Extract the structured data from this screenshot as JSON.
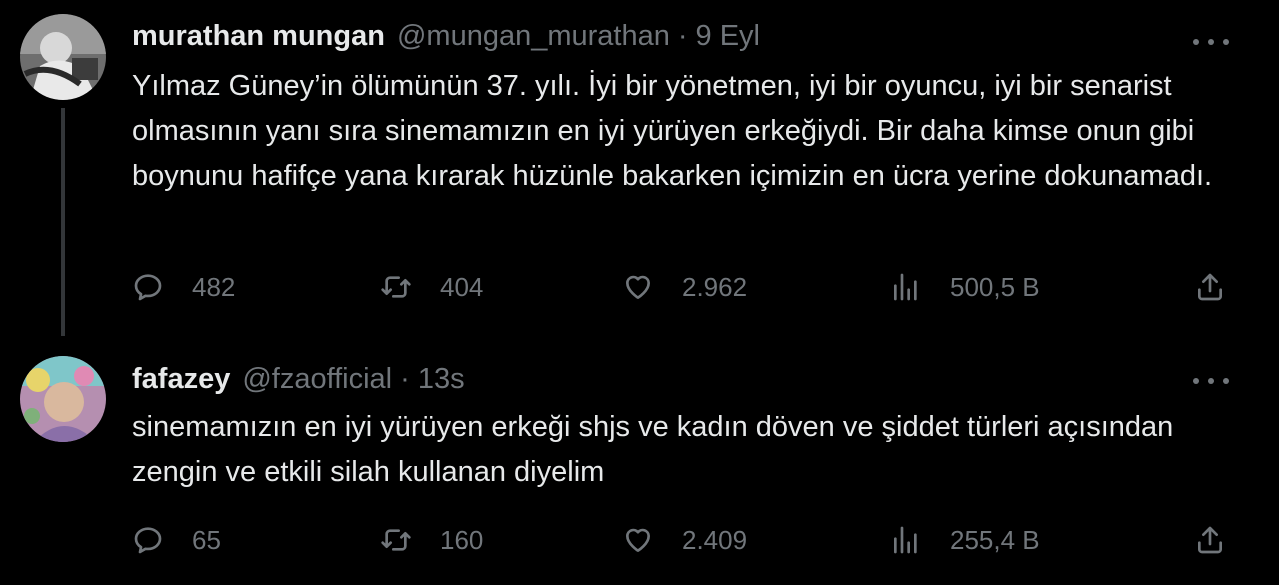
{
  "tweets": [
    {
      "author_name": "murathan mungan",
      "handle": "@mungan_murathan",
      "separator": "·",
      "time": "9 Eyl",
      "text": "Yılmaz Güney’in ölümünün 37.  yılı. İyi bir yönetmen, iyi bir oyuncu, iyi bir senarist olmasının yanı sıra sinemamızın en iyi yürüyen erkeğiydi. Bir daha kimse onun gibi boynunu hafifçe yana kırarak hüzünle bakarken içimizin en ücra yerine dokunamadı.",
      "replies": "482",
      "retweets": "404",
      "likes": "2.962",
      "views": "500,5 B"
    },
    {
      "author_name": "fafazey",
      "handle": "@fzaofficial",
      "separator": "·",
      "time": "13s",
      "text": "sinemamızın en iyi yürüyen erkeği shjs ve kadın döven ve şiddet türleri açısından zengin ve etkili silah kullanan diyelim",
      "replies": "65",
      "retweets": "160",
      "likes": "2.409",
      "views": "255,4 B"
    }
  ],
  "icons": {
    "reply": "reply-icon",
    "retweet": "retweet-icon",
    "like": "heart-icon",
    "views": "views-chart-icon",
    "share": "share-icon",
    "more": "more-dots-icon"
  },
  "colors": {
    "background": "#000000",
    "text": "#e7e9ea",
    "secondary": "#71767b",
    "thread_line": "#333639"
  }
}
